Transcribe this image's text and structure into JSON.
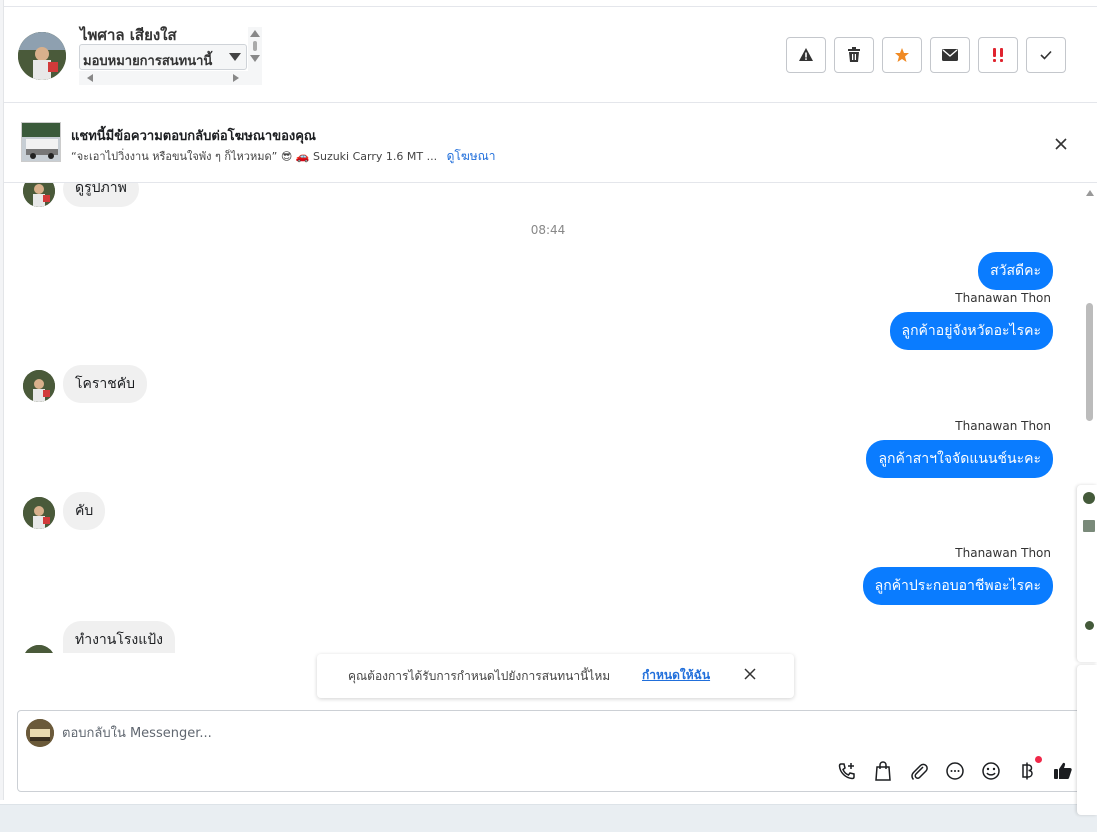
{
  "header": {
    "user_name": "ไพศาล เสียงใส",
    "assign_label": "มอบหมายการสนทนานี้"
  },
  "ad_banner": {
    "title": "แชทนี้มีข้อความตอบกลับต่อโฆษณาของคุณ",
    "subtitle": "“จะเอาไปวิ่งงาน หรือขนใจพัง ๆ ก็ไหวหมด” 😎 🚗 Suzuki Carry 1.6 MT ...",
    "link": "ดูโฆษณา",
    "close_icon": "close-icon"
  },
  "messages": {
    "incoming_1": "ดูรูปภาพ",
    "time_1": "08:44",
    "outgoing_1": "สวัสดีคะ",
    "sender_1": "Thanawan Thon",
    "outgoing_2": "ลูกค้าอยู่จังหวัดอะไรคะ",
    "incoming_2": "โคราชคับ",
    "sender_2": "Thanawan Thon",
    "outgoing_3": "ลูกค้าสาฯใจจัดแนนช์นะคะ",
    "incoming_3": "คับ",
    "sender_3": "Thanawan Thon",
    "outgoing_4": "ลูกค้าประกอบอาชีพอะไรคะ",
    "incoming_4": "ทำงานโรงแป้ง"
  },
  "toast": {
    "text": "คุณต้องการได้รับการกำหนดไปยังการสนทนานี้ไหม",
    "link": "กำหนดให้ฉัน"
  },
  "composer": {
    "placeholder": "ตอบกลับใน Messenger..."
  },
  "icons": [
    "warning-icon",
    "trash-icon",
    "star-icon",
    "envelope-icon",
    "urgent-icon",
    "check-icon",
    "call-add-icon",
    "shopping-bag-icon",
    "attachment-icon",
    "chat-bubble-icon",
    "emoji-icon",
    "baht-icon",
    "thumbs-up-icon"
  ],
  "colors": {
    "accent": "#0a7cff",
    "link": "#216fdb",
    "star": "#f08a24",
    "urgent": "#e0242f",
    "notification": "#f02849"
  }
}
